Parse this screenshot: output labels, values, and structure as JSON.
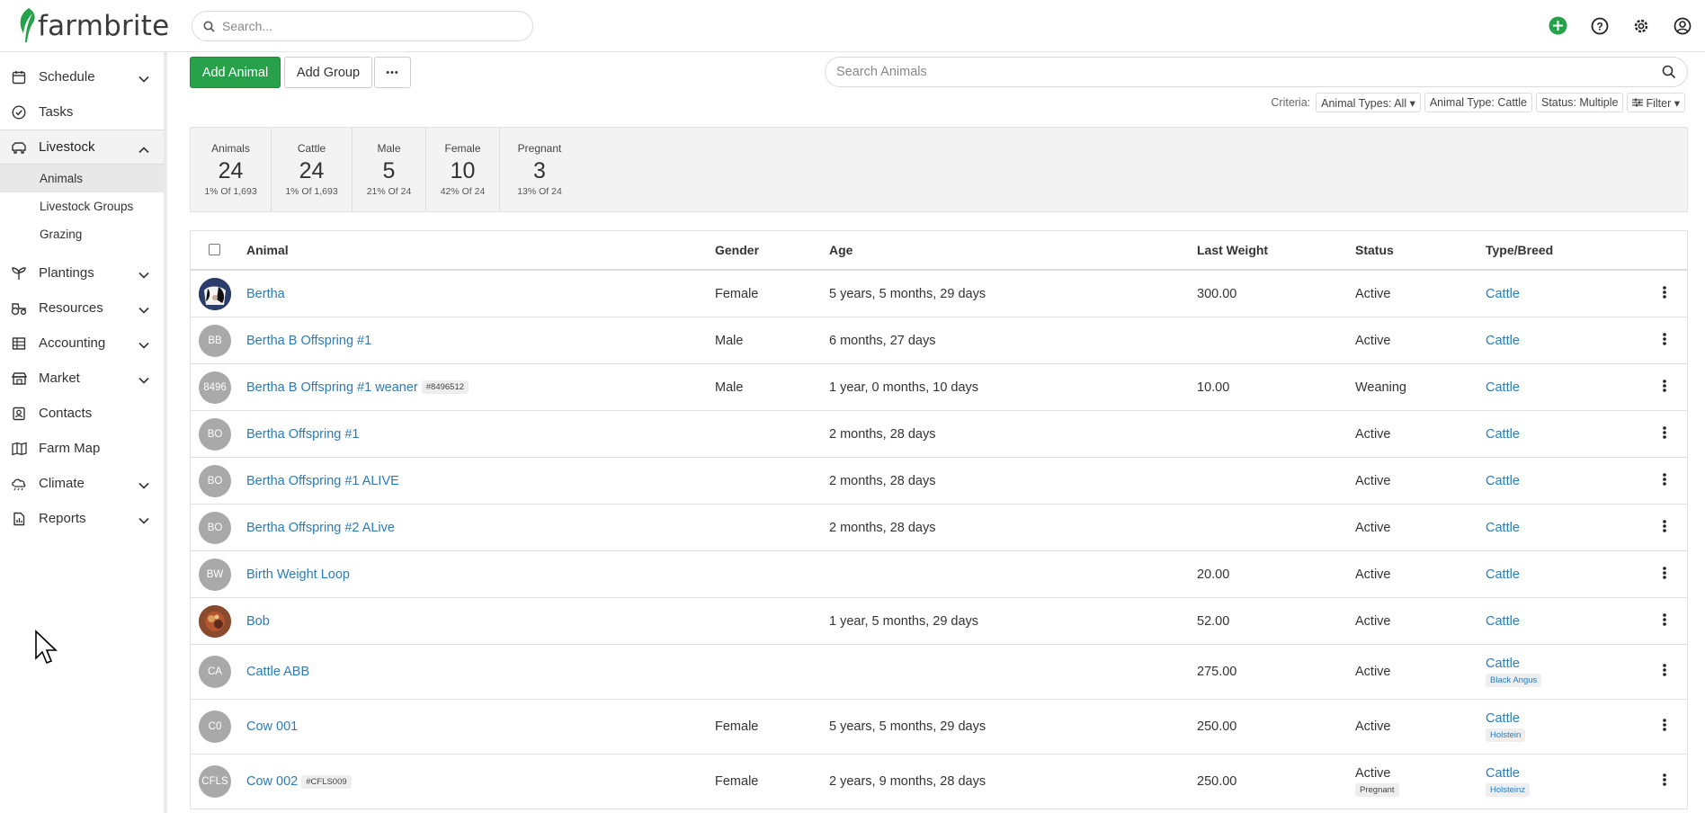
{
  "app": {
    "logo_text": "farmbrite",
    "search_placeholder": "Search..."
  },
  "sidebar": {
    "items": [
      {
        "label": "Schedule",
        "icon": "calendar-icon",
        "expandable": true
      },
      {
        "label": "Tasks",
        "icon": "check-circle-icon",
        "expandable": false
      },
      {
        "label": "Livestock",
        "icon": "livestock-icon",
        "expandable": true,
        "expanded": true
      },
      {
        "label": "Plantings",
        "icon": "sprout-icon",
        "expandable": true
      },
      {
        "label": "Resources",
        "icon": "tractor-icon",
        "expandable": true
      },
      {
        "label": "Accounting",
        "icon": "ledger-icon",
        "expandable": true
      },
      {
        "label": "Market",
        "icon": "market-icon",
        "expandable": true
      },
      {
        "label": "Contacts",
        "icon": "contacts-icon",
        "expandable": false
      },
      {
        "label": "Farm Map",
        "icon": "map-icon",
        "expandable": false
      },
      {
        "label": "Climate",
        "icon": "cloud-icon",
        "expandable": true
      },
      {
        "label": "Reports",
        "icon": "report-icon",
        "expandable": true
      }
    ],
    "livestock_sub": [
      "Animals",
      "Livestock Groups",
      "Grazing"
    ]
  },
  "toolbar": {
    "add_animal": "Add Animal",
    "add_group": "Add Group",
    "more": "•••",
    "search_placeholder": "Search Animals"
  },
  "criteria": {
    "label": "Criteria:",
    "chips": [
      "Animal Types: All ▾",
      "Animal Type: Cattle",
      "Status: Multiple",
      "Filter ▾"
    ]
  },
  "stats": [
    {
      "label": "Animals",
      "value": "24",
      "sub": "1% Of 1,693"
    },
    {
      "label": "Cattle",
      "value": "24",
      "sub": "1% Of 1,693"
    },
    {
      "label": "Male",
      "value": "5",
      "sub": "21% Of 24"
    },
    {
      "label": "Female",
      "value": "10",
      "sub": "42% Of 24"
    },
    {
      "label": "Pregnant",
      "value": "3",
      "sub": "13% Of 24"
    }
  ],
  "table": {
    "columns": [
      "Animal",
      "Gender",
      "Age",
      "Last Weight",
      "Status",
      "Type/Breed"
    ],
    "rows": [
      {
        "avatar": "",
        "photo": "cow",
        "name": "Bertha",
        "tag": "",
        "gender": "Female",
        "age": "5 years, 5 months, 29 days",
        "weight": "300.00",
        "status": "Active",
        "status_tag": "",
        "type": "Cattle",
        "breed": ""
      },
      {
        "avatar": "BB",
        "photo": "",
        "name": "Bertha B Offspring #1",
        "tag": "",
        "gender": "Male",
        "age": "6 months, 27 days",
        "weight": "",
        "status": "Active",
        "status_tag": "",
        "type": "Cattle",
        "breed": ""
      },
      {
        "avatar": "8496",
        "photo": "",
        "name": "Bertha B Offspring #1 weaner",
        "tag": "#8496512",
        "gender": "Male",
        "age": "1 year, 0 months, 10 days",
        "weight": "10.00",
        "status": "Weaning",
        "status_tag": "",
        "type": "Cattle",
        "breed": ""
      },
      {
        "avatar": "BO",
        "photo": "",
        "name": "Bertha Offspring #1",
        "tag": "",
        "gender": "",
        "age": "2 months, 28 days",
        "weight": "",
        "status": "Active",
        "status_tag": "",
        "type": "Cattle",
        "breed": ""
      },
      {
        "avatar": "BO",
        "photo": "",
        "name": "Bertha Offspring #1 ALIVE",
        "tag": "",
        "gender": "",
        "age": "2 months, 28 days",
        "weight": "",
        "status": "Active",
        "status_tag": "",
        "type": "Cattle",
        "breed": ""
      },
      {
        "avatar": "BO",
        "photo": "",
        "name": "Bertha Offspring #2 ALive",
        "tag": "",
        "gender": "",
        "age": "2 months, 28 days",
        "weight": "",
        "status": "Active",
        "status_tag": "",
        "type": "Cattle",
        "breed": ""
      },
      {
        "avatar": "BW",
        "photo": "",
        "name": "Birth Weight Loop",
        "tag": "",
        "gender": "",
        "age": "",
        "weight": "20.00",
        "status": "Active",
        "status_tag": "",
        "type": "Cattle",
        "breed": ""
      },
      {
        "avatar": "",
        "photo": "bob",
        "name": "Bob",
        "tag": "",
        "gender": "",
        "age": "1 year, 5 months, 29 days",
        "weight": "52.00",
        "status": "Active",
        "status_tag": "",
        "type": "Cattle",
        "breed": ""
      },
      {
        "avatar": "CA",
        "photo": "",
        "name": "Cattle ABB",
        "tag": "",
        "gender": "",
        "age": "",
        "weight": "275.00",
        "status": "Active",
        "status_tag": "",
        "type": "Cattle",
        "breed": "Black Angus"
      },
      {
        "avatar": "C0",
        "photo": "",
        "name": "Cow 001",
        "tag": "",
        "gender": "Female",
        "age": "5 years, 5 months, 29 days",
        "weight": "250.00",
        "status": "Active",
        "status_tag": "",
        "type": "Cattle",
        "breed": "Holstein"
      },
      {
        "avatar": "CFLS",
        "photo": "",
        "name": "Cow 002",
        "tag": "#CFLS009",
        "gender": "Female",
        "age": "2 years, 9 months, 28 days",
        "weight": "250.00",
        "status": "Active",
        "status_tag": "Pregnant",
        "type": "Cattle",
        "breed": "Holsteinz"
      }
    ]
  },
  "colors": {
    "brand_green": "#27a14a",
    "link_blue": "#2b7bb9"
  }
}
